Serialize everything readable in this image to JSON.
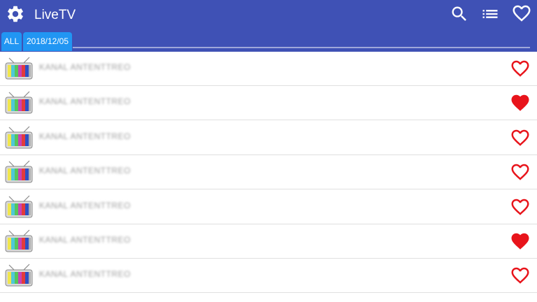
{
  "app": {
    "title": "LiveTV"
  },
  "toolbar": {
    "settings_icon": "gear-icon",
    "search_icon": "search-icon",
    "list_icon": "list-icon",
    "favorites_icon": "heart-outline-icon"
  },
  "tabs": [
    {
      "label": "ALL",
      "selected": true
    },
    {
      "label": "2018/12/05",
      "selected": false
    }
  ],
  "channels": [
    {
      "name": "KANAL ANTENTTREO",
      "favorite": false
    },
    {
      "name": "KANAL ANTENTTREO",
      "favorite": true
    },
    {
      "name": "KANAL ANTENTTREO",
      "favorite": false
    },
    {
      "name": "KANAL ANTENTTREO",
      "favorite": false
    },
    {
      "name": "KANAL ANTENTTREO",
      "favorite": false
    },
    {
      "name": "KANAL ANTENTTREO",
      "favorite": true
    },
    {
      "name": "KANAL ANTENTTREO",
      "favorite": false
    }
  ],
  "colors": {
    "appbar": "#3f51b5",
    "tab": "#2196f3",
    "heart": "#e8141b"
  }
}
